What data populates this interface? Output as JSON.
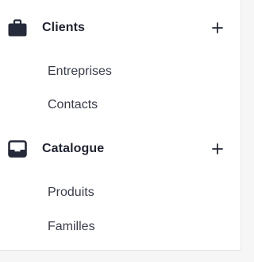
{
  "sections": [
    {
      "title": "Clients",
      "icon": "briefcase-icon",
      "expand_icon": "plus-icon",
      "items": [
        {
          "label": "Entreprises"
        },
        {
          "label": "Contacts"
        }
      ]
    },
    {
      "title": "Catalogue",
      "icon": "inbox-icon",
      "expand_icon": "plus-icon",
      "items": [
        {
          "label": "Produits"
        },
        {
          "label": "Familles"
        }
      ]
    }
  ],
  "colors": {
    "icon": "#252a3a",
    "heading_text": "#1f2230",
    "item_text": "#3a3d4a",
    "panel_bg": "#ffffff",
    "page_bg": "#f6f6f7"
  }
}
